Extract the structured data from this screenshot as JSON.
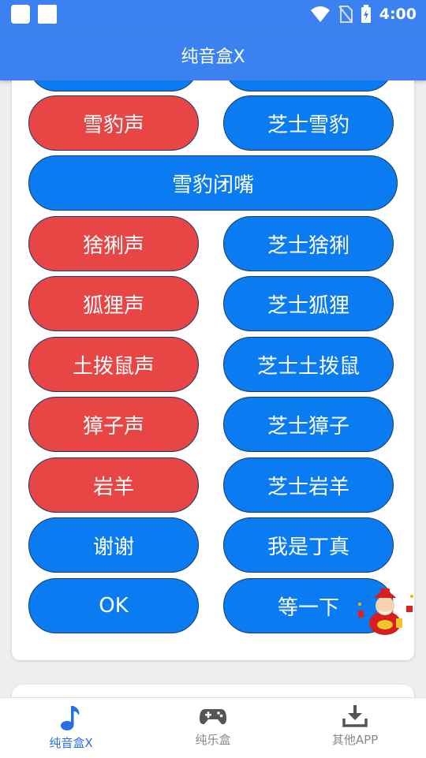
{
  "status_bar": {
    "time": "4:00"
  },
  "app_title": "纯音盒X",
  "buttons_partial_top": [
    "",
    ""
  ],
  "rows": [
    {
      "left": "雪豹声",
      "left_color": "red",
      "right": "芝士雪豹",
      "right_color": "blue"
    },
    {
      "full": "雪豹闭嘴",
      "full_color": "blue"
    },
    {
      "left": "猞猁声",
      "left_color": "red",
      "right": "芝士猞猁",
      "right_color": "blue"
    },
    {
      "left": "狐狸声",
      "left_color": "red",
      "right": "芝士狐狸",
      "right_color": "blue"
    },
    {
      "left": "土拨鼠声",
      "left_color": "red",
      "right": "芝士土拨鼠",
      "right_color": "blue"
    },
    {
      "left": "獐子声",
      "left_color": "red",
      "right": "芝士獐子",
      "right_color": "blue"
    },
    {
      "left": "岩羊",
      "left_color": "red",
      "right": "芝士岩羊",
      "right_color": "blue"
    },
    {
      "left": "谢谢",
      "left_color": "blue",
      "right": "我是丁真",
      "right_color": "blue"
    },
    {
      "left": "OK",
      "left_color": "blue",
      "right": "等一下",
      "right_color": "blue"
    }
  ],
  "bottom_nav": [
    {
      "label": "纯音盒X",
      "icon": "music-note-icon",
      "active": true
    },
    {
      "label": "纯乐盒",
      "icon": "gamepad-icon",
      "active": false
    },
    {
      "label": "其他APP",
      "icon": "download-icon",
      "active": false
    }
  ],
  "colors": {
    "primary": "#3b82f0",
    "red_button": "#e84545",
    "blue_button": "#0b7bf2",
    "nav_active": "#2a6fe0"
  }
}
